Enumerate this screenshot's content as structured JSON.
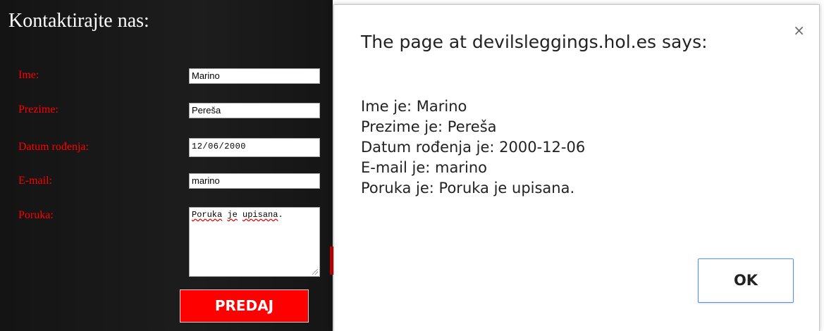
{
  "form": {
    "title": "Kontaktirajte nas:",
    "fields": [
      {
        "label": "Ime:",
        "value": "Marino"
      },
      {
        "label": "Prezime:",
        "value": "Pereša"
      },
      {
        "label": "Datum rođenja:",
        "value": "12/06/2000"
      },
      {
        "label": "E-mail:",
        "value": "marino"
      },
      {
        "label": "Poruka:",
        "value_words": [
          "Poruka",
          "je",
          "upisana",
          "."
        ]
      }
    ],
    "submit_label": "PREDAJ",
    "label_color": "#ff0000",
    "submit_color": "#ff0000"
  },
  "dialog": {
    "title": "The page at devilsleggings.hol.es says:",
    "close_icon": "close-icon",
    "close_glyph": "×",
    "lines": [
      "Ime je: Marino",
      "Prezime je: Pereša",
      "Datum rođenja je: 2000-12-06",
      "E-mail je: marino",
      "Poruka je: Poruka je upisana."
    ],
    "ok_label": "OK",
    "ok_border_color": "#4d90fe"
  }
}
